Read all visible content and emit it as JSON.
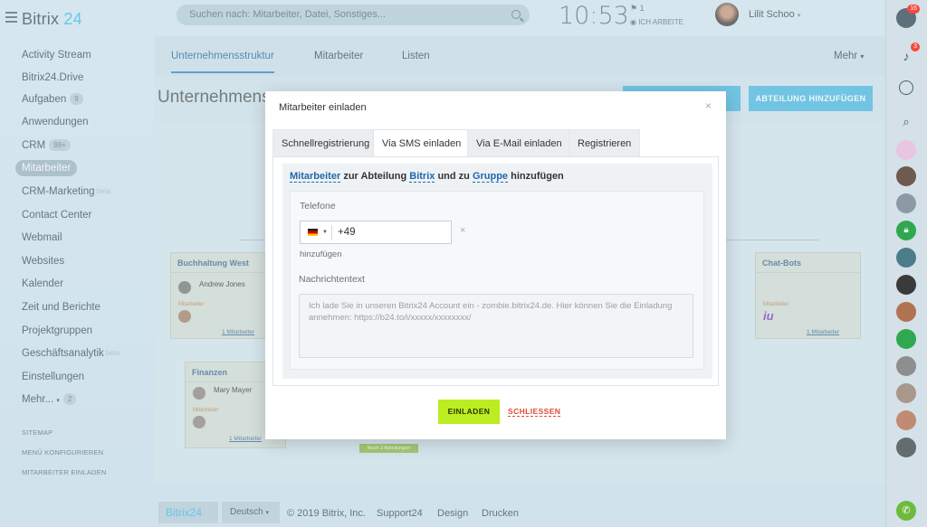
{
  "app": {
    "logo_prefix": "Bitrix",
    "logo_suffix": "24"
  },
  "header": {
    "search_placeholder": "Suchen nach: Mitarbeiter, Datei, Sonstiges...",
    "clock": "10:53",
    "flag_count": "1",
    "work_status": "ICH ARBEITE",
    "user_name": "Lilit Schoo"
  },
  "sidebar": {
    "items": [
      {
        "label": "Activity Stream"
      },
      {
        "label": "Bitrix24.Drive"
      },
      {
        "label": "Aufgaben",
        "count": "9"
      },
      {
        "label": "Anwendungen"
      },
      {
        "label": "CRM",
        "count": "99+"
      },
      {
        "label": "Mitarbeiter"
      },
      {
        "label": "CRM-Marketing",
        "tag": "beta"
      },
      {
        "label": "Contact Center"
      },
      {
        "label": "Webmail"
      },
      {
        "label": "Websites"
      },
      {
        "label": "Kalender"
      },
      {
        "label": "Zeit und Berichte"
      },
      {
        "label": "Projektgruppen"
      },
      {
        "label": "Geschäftsanalytik",
        "tag": "beta"
      },
      {
        "label": "Einstellungen"
      },
      {
        "label": "Mehr...",
        "count": "2"
      }
    ],
    "sitemap": "SITEMAP",
    "configure": "MENÜ KONFIGURIEREN",
    "invite": "MITARBEITER EINLADEN"
  },
  "page": {
    "tabs": [
      "Unternehmensstruktur",
      "Mitarbeiter",
      "Listen"
    ],
    "more": "Mehr",
    "title": "Unternehmens",
    "add_dept_button": "ABTEILUNG HINZUFÜGEN",
    "cards": {
      "buchhaltung": {
        "title": "Buchhaltung West",
        "person": "Andrew Jones",
        "role": "Mitarbeiter",
        "link": "1 Mitarbeiter"
      },
      "finanzen": {
        "title": "Finanzen",
        "person": "Mary Mayer",
        "role": "Mitarbeiter",
        "link": "1 Mitarbeiter"
      },
      "chatbots": {
        "title": "Chat-Bots",
        "role": "Mitarbeiter",
        "link": "1 Mitarbeiter"
      },
      "sub_label": "Noch 3 Abteilungen"
    }
  },
  "footer": {
    "logo": "Bitrix24",
    "language": "Deutsch",
    "copyright": "© 2019 Bitrix, Inc.",
    "support": "Support24",
    "design": "Design",
    "print": "Drucken"
  },
  "rightbar": {
    "help_badge": "16",
    "notify_badge": "3"
  },
  "modal": {
    "title": "Mitarbeiter einladen",
    "close_glyph": "×",
    "tabs": [
      "Schnellregistrierung",
      "Via SMS einladen",
      "Via E-Mail einladen",
      "Registrieren"
    ],
    "header_link1": "Mitarbeiter",
    "header_text1": "zur Abteilung",
    "header_link2": "Bitrix",
    "header_text2": "und zu",
    "header_link3": "Gruppe",
    "header_text3": "hinzufügen",
    "phone_label": "Telefone",
    "phone_value": "+49",
    "phone_remove": "×",
    "add_link": "hinzufügen",
    "message_label": "Nachrichtentext",
    "message_text": "Ich lade Sie in unseren Bitrix24 Account ein - zombie.bitrix24.de. Hier können Sie die Einladung annehmen: https://b24.to/i/xxxxx/xxxxxxxx/",
    "invite_button": "EINLADEN",
    "close_button": "SCHLIESSEN"
  }
}
